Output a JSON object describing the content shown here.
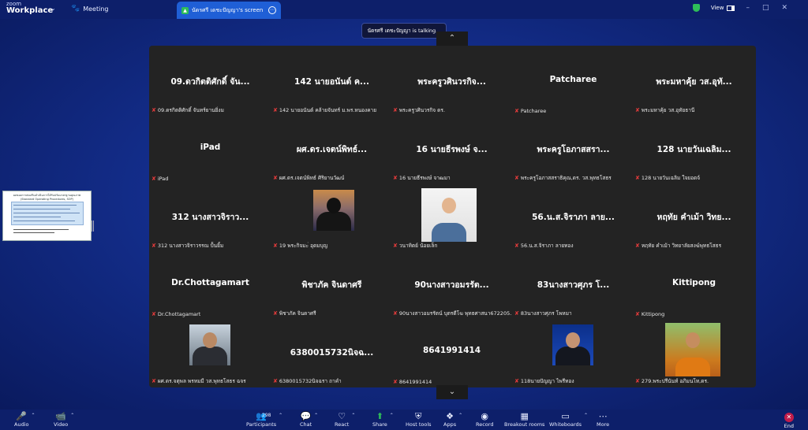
{
  "app": {
    "logo_line1": "zoom",
    "logo_line2": "Workplace",
    "meeting_label": "Meeting"
  },
  "share_tab": {
    "title": "นัดรศรี เดชะปัญญา's screen"
  },
  "top_right": {
    "view_label": "View"
  },
  "talking_banner": "นัดรศรี เดชะปัญญา is talking...",
  "slide": {
    "title": "ผลของการส่งเสริมดำเนินการได้รับปรับมาตรฐานคุณภาพ",
    "subtitle": "(Standard Operating Procedures, SOP)"
  },
  "participants": [
    {
      "display": "09.ดวกิตติศักดิ์ จัน...",
      "label": "09.ดรกิตติศักดิ์ จันทร์ยานยิ่งม",
      "photo": ""
    },
    {
      "display": "142 นายอนันต์ ค...",
      "label": "142 นายอนันต์ คล้ายจันทร์ ม.พร.หนองคาย",
      "photo": ""
    },
    {
      "display": "พระครูวศินวรกิจ...",
      "label": "พระครูวศินวรกิจ ดร.",
      "photo": ""
    },
    {
      "display": "Patcharee",
      "label": "Patcharee",
      "photo": ""
    },
    {
      "display": "พระมหาคุ้ย วส.อุทั...",
      "label": "พระมหาคุ้ย วส.อุทัยธานี",
      "photo": ""
    },
    {
      "display": "iPad",
      "label": "iPad",
      "photo": ""
    },
    {
      "display": "ผศ.ดร.เจตน์พิทธ์...",
      "label": "ผศ.ดร.เจตน์พิทธ์ ศิริยานวัฒน์",
      "photo": ""
    },
    {
      "display": "16 นายธีรพงษ์ จ...",
      "label": "16 นายธีรพงษ์ จาฒมา",
      "photo": ""
    },
    {
      "display": "พระครูโอภาสสรา...",
      "label": "พระครูโอภาสสราธิคุณ,ดร. วส.พุทธโสธร",
      "photo": ""
    },
    {
      "display": "128 นายวันเฉลิม...",
      "label": "128 นายวันเฉลิม ใจยอดจ์",
      "photo": ""
    },
    {
      "display": "312 นางสาวจิราว...",
      "label": "312 นางสาวจิราวรรณ ปั้นยิ้ม",
      "photo": ""
    },
    {
      "display": "",
      "label": "19 พระกิจมะ่ อุดมบุญ",
      "photo": "silhouette"
    },
    {
      "display": "",
      "label": "วนาทิตย์ น้อยเล็ก",
      "photo": "woman"
    },
    {
      "display": "56.น.ส.จิราภา ลาย...",
      "label": "56.น.ส.จิราภา ลายทอง",
      "photo": ""
    },
    {
      "display": "หฤทัย คำเม้า วิทย...",
      "label": "หฤทัย คำเม้า วิทยาลัยสงฆ์พุทธโสธร",
      "photo": ""
    },
    {
      "display": "Dr.Chottagamart",
      "label": "Dr.Chottagamart",
      "photo": ""
    },
    {
      "display": "พิชาภัค จินดาศรี",
      "label": "พิชาภัค จินดาศรี",
      "photo": ""
    },
    {
      "display": "90นางสาวอมรรัต...",
      "label": "90นางสาวอมรรัตน์ บุตรดีโฆ พุทธศาสนา672205...",
      "photo": ""
    },
    {
      "display": "83นางสาวศุภร โ...",
      "label": "83นางสาวศุภร โพหมา",
      "photo": ""
    },
    {
      "display": "Kittipong",
      "label": "Kittipong",
      "photo": ""
    },
    {
      "display": "",
      "label": "ผศ.ดร.จตุพล พรหมมี วส.พุทธโสธร ฉจร",
      "photo": "man1"
    },
    {
      "display": "6380015732นิจฉ...",
      "label": "6380015732นิจฉรา ถาคำ",
      "photo": ""
    },
    {
      "display": "8641991414",
      "label": "8641991414",
      "photo": ""
    },
    {
      "display": "",
      "label": "118นายปัญญา ไพรีทอง",
      "photo": "man2"
    },
    {
      "display": "",
      "label": "279.พระปรีนันท์ อภิมนโท,ดร.",
      "photo": "monk"
    }
  ],
  "toolbar": {
    "audio": "Audio",
    "video": "Video",
    "participants": "Participants",
    "participants_count": "298",
    "chat": "Chat",
    "react": "React",
    "share": "Share",
    "host_tools": "Host tools",
    "apps": "Apps",
    "record": "Record",
    "breakout_rooms": "Breakout rooms",
    "whiteboards": "Whiteboards",
    "more": "More",
    "end": "End"
  }
}
